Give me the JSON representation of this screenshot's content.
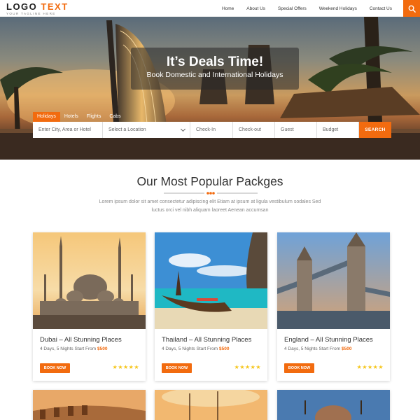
{
  "header": {
    "logo_main": "LOGO",
    "logo_accent": "TEXT",
    "logo_tagline": "YOUR TAGLINE HERE",
    "nav": [
      "Home",
      "About Us",
      "Special Offers",
      "Weekend Holidays",
      "Contact Us"
    ],
    "search_icon": "search-icon"
  },
  "hero": {
    "title": "It’s Deals Time!",
    "subtitle": "Book Domestic and International Holidays",
    "tabs": [
      "Holidays",
      "Hotels",
      "Flights",
      "Cabs"
    ],
    "active_tab": "Holidays",
    "fields": {
      "location_placeholder": "Enter City, Area or Hotel",
      "select_location": "Select a Location",
      "checkin": "Check-In",
      "checkout": "Check-out",
      "guest": "Guest",
      "budget": "Budget"
    },
    "search_button": "SEARCH"
  },
  "section": {
    "title": "Our Most Popular Packges",
    "text": "Lorem ipsum dolor sit amet consectetur adipiscing elit Etiam at ipsum at ligula vestibulum sodales Sed luctus orci vel nibh aliquam laoreet Aenean accumsan"
  },
  "cards": [
    {
      "title": "Dubai – All Stunning Places",
      "sub": "4 Days, 5 Nights Start From",
      "price": "$500",
      "button": "BOOK NOW",
      "rating": 5
    },
    {
      "title": "Thailand – All Stunning Places",
      "sub": "4 Days, 5 Nights Start From",
      "price": "$500",
      "button": "BOOK NOW",
      "rating": 5
    },
    {
      "title": "England – All Stunning Places",
      "sub": "4 Days, 5 Nights Start From",
      "price": "$500",
      "button": "BOOK NOW",
      "rating": 5
    }
  ],
  "colors": {
    "accent": "#f26b0f",
    "stars": "#f5c518"
  }
}
